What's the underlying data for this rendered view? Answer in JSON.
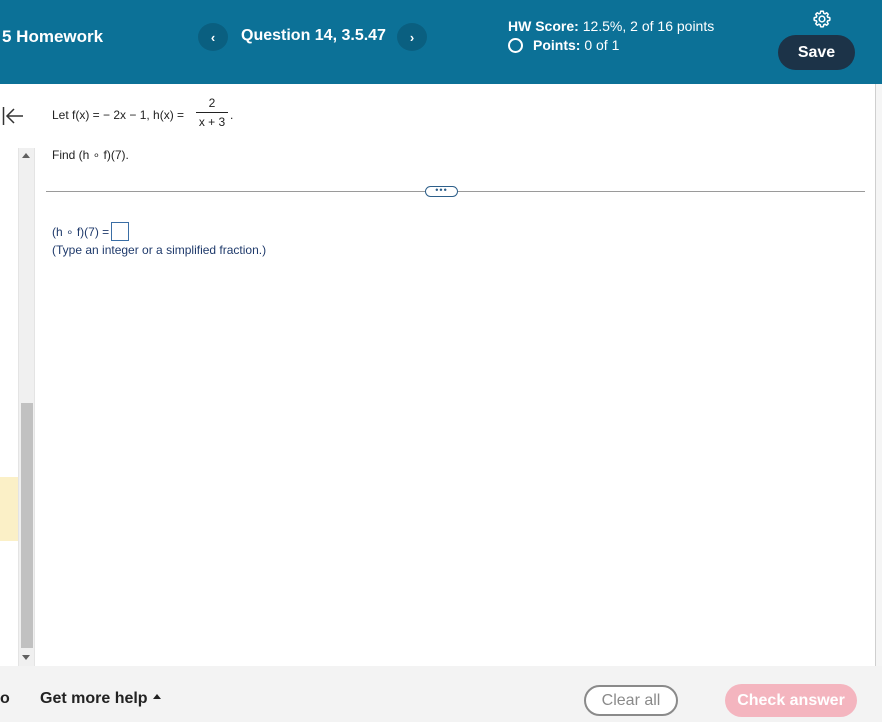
{
  "header": {
    "homework_title": "5 Homework",
    "prev_label": "‹",
    "next_label": "›",
    "question_title": "Question 14, 3.5.47",
    "score_label": "HW Score:",
    "score_value": "12.5%, 2 of 16 points",
    "points_label": "Points:",
    "points_value": "0 of 1",
    "save_label": "Save",
    "settings_icon": "gear-icon"
  },
  "side": {
    "collapse_icon": "collapse-left-icon"
  },
  "question": {
    "let_text": "Let f(x) = − 2x − 1, h(x) = ",
    "frac_num": "2",
    "frac_den": "x + 3",
    "period": ".",
    "find_text": "Find (h ∘ f)(7).",
    "expand_label": "•••",
    "answer_prefix": "(h ∘ f)(7) = ",
    "answer_value": "",
    "hint": "(Type an integer or a simplified fraction.)"
  },
  "footer": {
    "left_fragment": "o",
    "help_label": "Get more help",
    "clear_label": "Clear all",
    "check_label": "Check answer"
  },
  "colors": {
    "header_bg": "#0c7197",
    "save_bg": "#1c3348",
    "check_bg": "#f4b5bf",
    "answer_text": "#1f3a6b"
  }
}
